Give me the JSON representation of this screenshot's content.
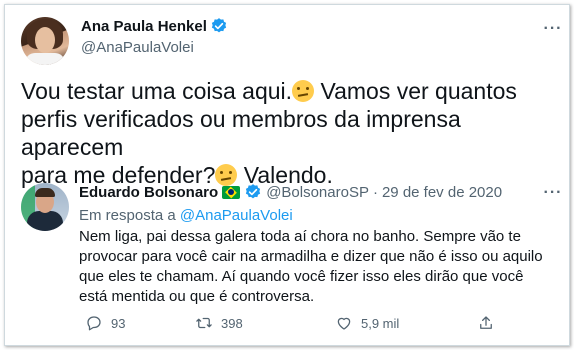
{
  "main_tweet": {
    "display_name": "Ana Paula Henkel",
    "handle": "@AnaPaulaVolei",
    "text_line1_a": "Vou testar uma coisa aqui.",
    "text_line1_b": " Vamos ver quantos",
    "text_line2": "perfis verificados ou membros da imprensa aparecem",
    "text_line3_a": "para me defender?",
    "text_line3_b": " Valendo.",
    "verified_color": "#1d9bf0"
  },
  "quoted_tweet": {
    "display_name": "Eduardo Bolsonaro",
    "handle": "@BolsonaroSP",
    "separator": "·",
    "date": "29 de fev de 2020",
    "reply_prefix": "Em resposta a ",
    "reply_handle": "@AnaPaulaVolei",
    "text": "Nem liga, pai dessa galera toda aí chora no banho. Sempre vão te provocar para você cair na armadilha e dizer que não é isso ou aquilo que eles te chamam. Aí quando você fizer isso eles dirão que você está mentida ou que é controversa.",
    "actions": {
      "reply_count": "93",
      "retweet_count": "398",
      "like_count": "5,9 mil"
    }
  },
  "icons": [
    "verified-badge-icon",
    "more-icon",
    "reply-icon",
    "retweet-icon",
    "like-icon",
    "share-icon",
    "thinking-emoji-icon",
    "brazil-flag-icon"
  ]
}
